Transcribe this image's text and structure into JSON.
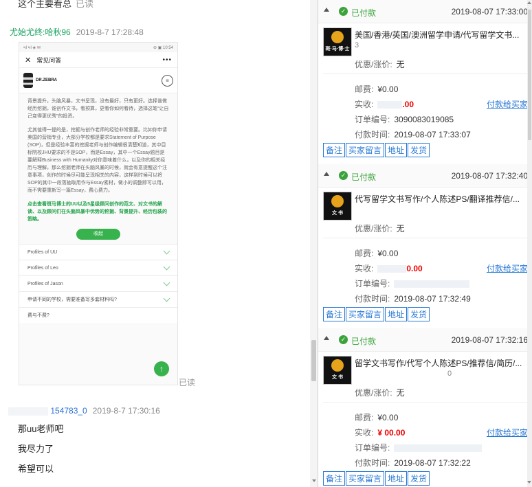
{
  "chat": {
    "top_message": "这个主要看总",
    "top_read": "已读",
    "msg1": {
      "nick": "尤始尤终:哈秋96",
      "time": "2019-8-7 17:28:48"
    },
    "phone": {
      "status_left": "•ıl •ıl ◈ ✉",
      "status_right": "⊘ ▣ 10:54",
      "title": "常见问答",
      "close_icon": "close-icon",
      "more_icon": "more-icon",
      "brand": "DR.ZEBRA",
      "para1": "背景提升，头脑风暴，文书呈现，没有最好，只有更好。选择谁做经历挖掘，谁创作文书，看预算，更看你如何看待，选择这笔“让自己变得更优秀”的投资。",
      "para2": "尤其值得一提的是，挖掘与创作老师的经验非常重要。比如你申请美国的营销专业，大部分学校都是要求Statement of Purpose (SOP)，但是经验丰富的挖掘老师与创作编辑很清楚知道，其中目标院校JHU要求的不是SOP，而是Essay，其中一个Essay题目是要解释Business with Humanity对你意味着什么，以及你的相关经历与理解，那么挖掘老师在头脑风暴的时候，就会有意提醒这个注意事项，创作的时候尽可能呈现相关的内容，这样到时候可以将SOP的其中一段落抽取用作与Essay素材，做小的调整即可以用，而不需要重新写一篇Essay，费心费力。",
      "para3": "点击查看斑马博士的UU以及5星级顾问创作的范文、对文书的解读、以及顾问们在头脑风暴中优势的挖掘、背景提升、经历包装的策略。",
      "collapse_label": "收起",
      "faq": [
        "Profiles of UU",
        "Profiles of Leo",
        "Profiles of Jason",
        "申请不同的学校，需要准备写多套材料吗?",
        "费与不费?"
      ],
      "fab_label": "↑"
    },
    "read_label": "已读",
    "msg2": {
      "nick": "154783_0",
      "time": "2019-8-7 17:30:16"
    },
    "lines": [
      "那uu老师吧",
      "我尽力了",
      "希望可以"
    ]
  },
  "orders": [
    {
      "status": "已付款",
      "time": "2019-08-07 17:33:00",
      "thumb_text": "斑·马·博·士",
      "title": "美国/香港/英国/澳洲留学申请/代写留学文书...",
      "subtitle": "3",
      "discount_label": "优惠/涨价:",
      "discount_value": "无",
      "postage_label": "邮费:",
      "postage_value": "¥0.00",
      "paid_label": "实收:",
      "paid_value": ".00",
      "pay_link": "付款给买家",
      "order_no_label": "订单编号:",
      "order_no_value": "3090083019085",
      "pay_time_label": "付款时间:",
      "pay_time_value": "2019-08-07 17:33:07",
      "buttons": [
        "备注",
        "买家留言",
        "地址",
        "发货"
      ]
    },
    {
      "status": "已付款",
      "time": "2019-08-07 17:32:40",
      "thumb_text": "文 书",
      "title": "代写留学文书写作/个人陈述PS/翻译推荐信/...",
      "subtitle": "",
      "discount_label": "优惠/涨价:",
      "discount_value": "无",
      "postage_label": "邮费:",
      "postage_value": "¥0.00",
      "paid_label": "实收:",
      "paid_value": "0.00",
      "pay_link": "付款给买家",
      "order_no_label": "订单编号:",
      "order_no_value": "",
      "pay_time_label": "付款时间:",
      "pay_time_value": "2019-08-07 17:32:49",
      "buttons": [
        "备注",
        "买家留言",
        "地址",
        "发货"
      ]
    },
    {
      "status": "已付款",
      "time": "2019-08-07 17:32:16",
      "thumb_text": "文 书",
      "title": "留学文书写作/代写个人陈述PS/推荐信/简历/...",
      "subtitle": "0",
      "discount_label": "优惠/涨价:",
      "discount_value": "无",
      "postage_label": "邮费:",
      "postage_value": "¥0.00",
      "paid_label": "实收:",
      "paid_value": "¥ 00.00",
      "pay_link": "付款给买家",
      "order_no_label": "订单编号:",
      "order_no_value": "",
      "pay_time_label": "付款时间:",
      "pay_time_value": "2019-08-07 17:32:22",
      "buttons": [
        "备注",
        "买家留言",
        "地址",
        "发货"
      ]
    }
  ],
  "colors": {
    "paid_green": "#3aa33a",
    "link_blue": "#2a7ad6",
    "amount_red": "#e00000",
    "nick_green": "#1aa260"
  }
}
